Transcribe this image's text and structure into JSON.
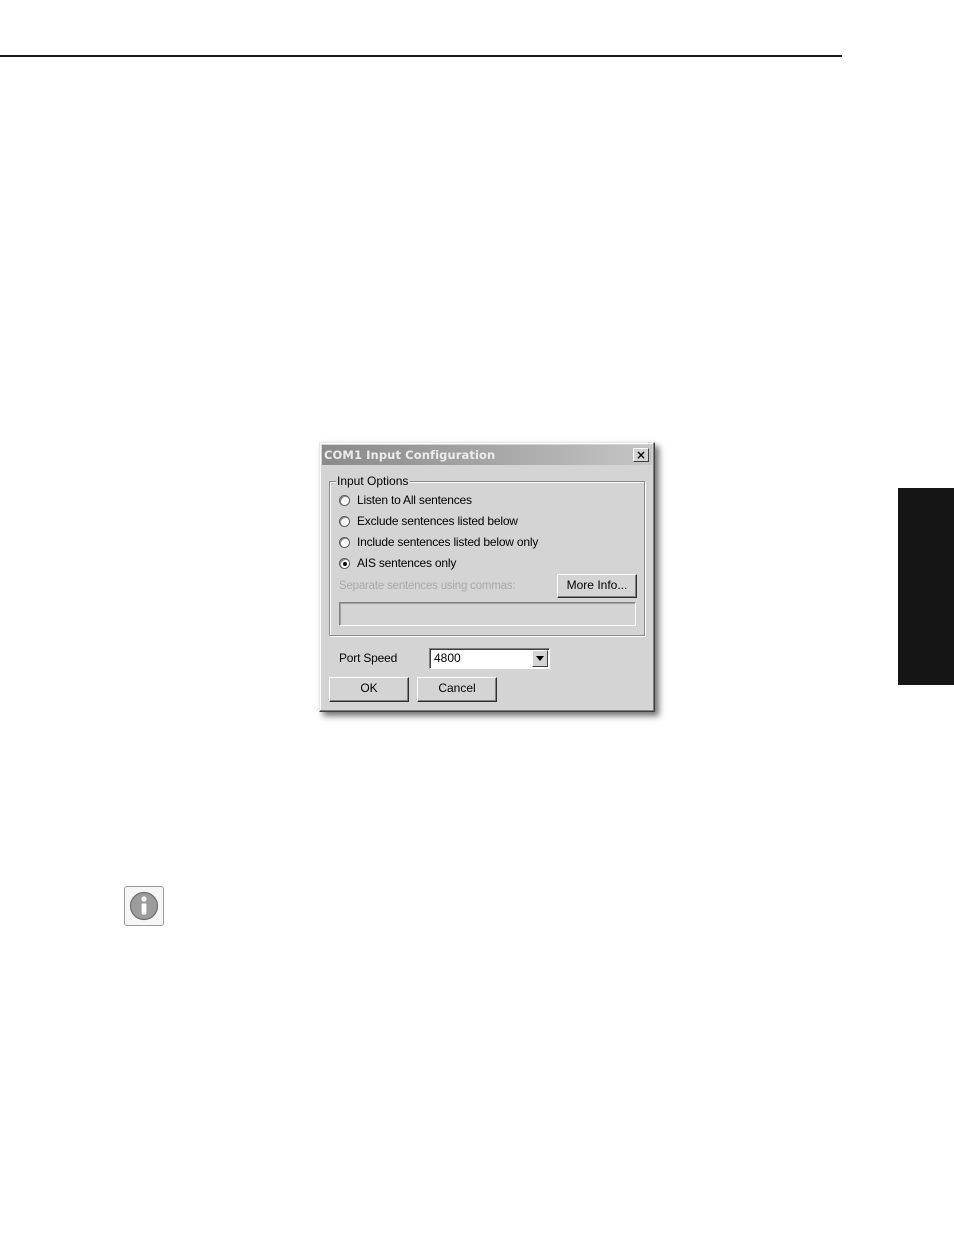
{
  "dialog": {
    "title": "COM1 Input Configuration",
    "close_glyph": "×",
    "input_options": {
      "legend": "Input Options",
      "radios": [
        {
          "label": "Listen to All sentences",
          "selected": false
        },
        {
          "label": "Exclude sentences listed below",
          "selected": false
        },
        {
          "label": "Include sentences listed below only",
          "selected": false
        },
        {
          "label": "AIS sentences only",
          "selected": true
        }
      ],
      "hint": "Separate sentences using commas:",
      "more_info_label": "More Info...",
      "sentences_value": ""
    },
    "port_speed": {
      "label": "Port Speed",
      "value": "4800"
    },
    "ok_label": "OK",
    "cancel_label": "Cancel"
  },
  "icons": {
    "close": "close-icon",
    "dropdown": "chevron-down-icon",
    "note": "info-icon"
  },
  "colors": {
    "dialog_face": "#d4d4d4",
    "side_tab": "#151515",
    "rule": "#1a1a1a"
  }
}
